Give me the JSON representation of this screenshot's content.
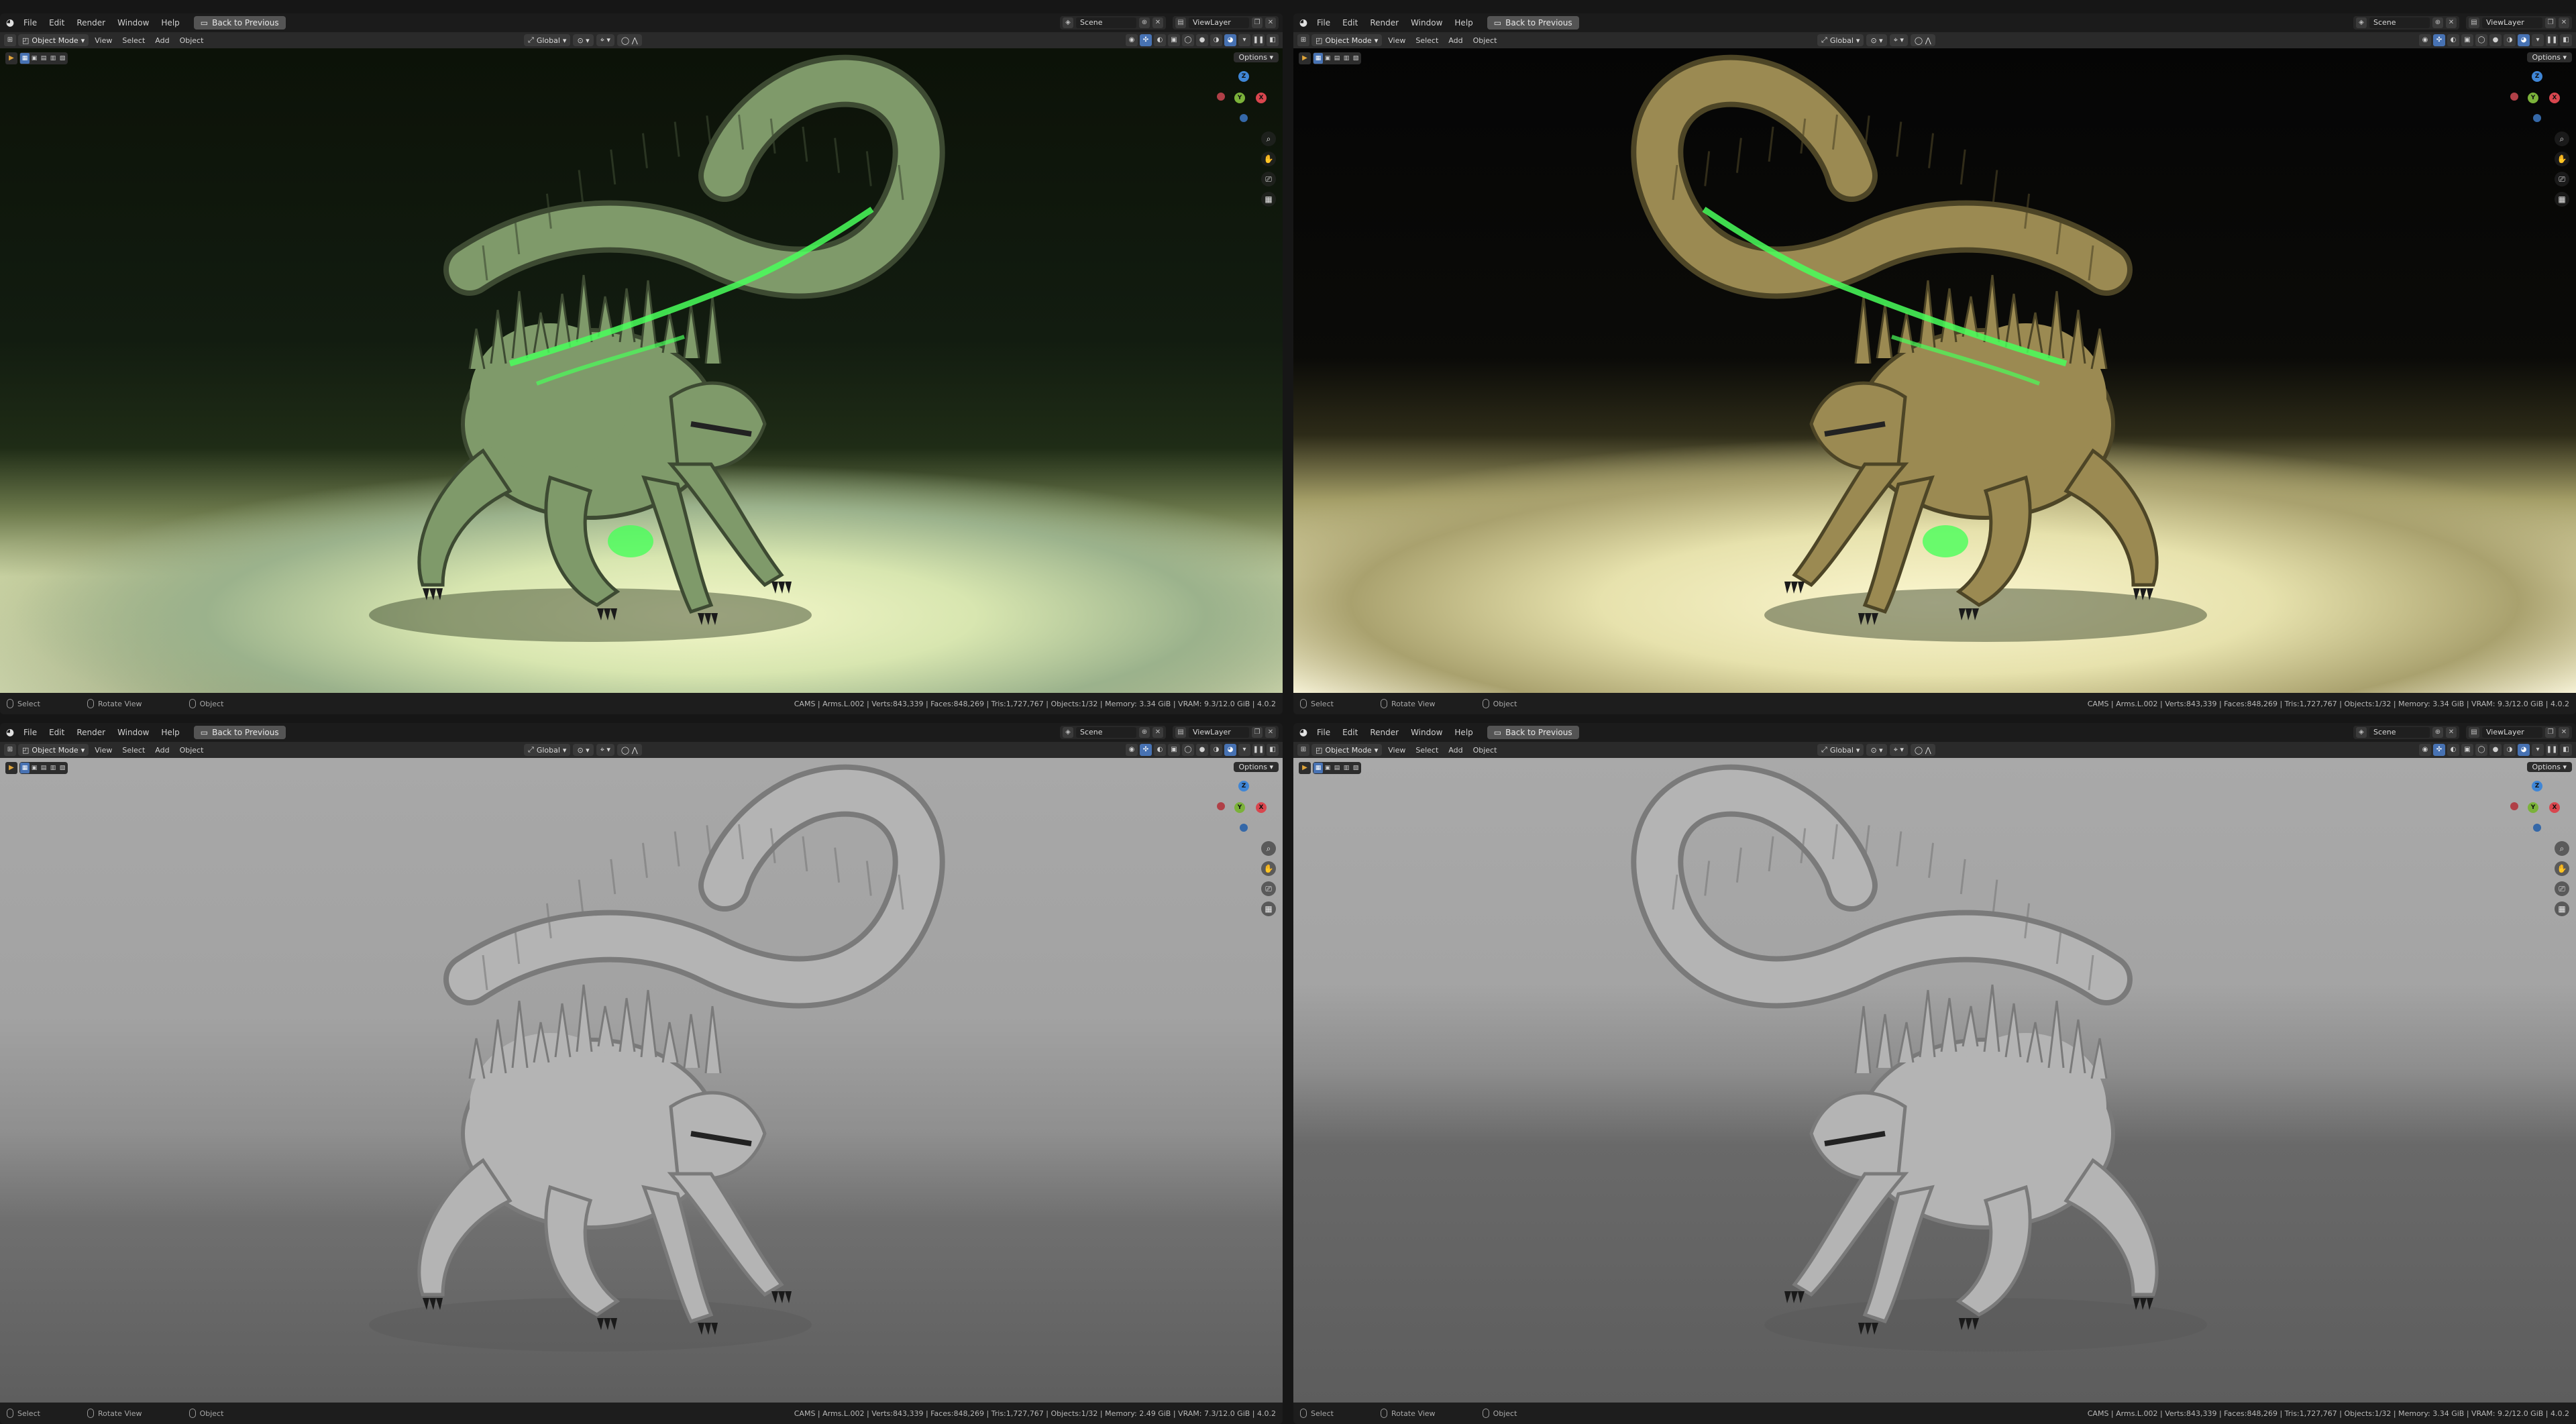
{
  "app": {
    "menus": [
      "File",
      "Edit",
      "Render",
      "Window",
      "Help"
    ],
    "back_button": "Back to Previous",
    "scene": "Scene",
    "view_layer": "ViewLayer"
  },
  "header": {
    "mode": "Object Mode",
    "menus": [
      "View",
      "Select",
      "Add",
      "Object"
    ],
    "transform_orientation": "Global",
    "options": "Options"
  },
  "gizmo": {
    "z": "Z",
    "y": "Y",
    "x": "X"
  },
  "windows": [
    {
      "shading": "rendered",
      "status": {
        "select": "Select",
        "rotate": "Rotate View",
        "object": "Object",
        "stats": "CAMS | Arms.L.002 | Verts:843,339 | Faces:848,269 | Tris:1,727,767 | Objects:1/32 | Memory: 3.34 GiB | VRAM: 9.3/12.0 GiB | 4.0.2"
      }
    },
    {
      "shading": "rendered",
      "status": {
        "select": "Select",
        "rotate": "Rotate View",
        "object": "Object",
        "stats": "CAMS | Arms.L.002 | Verts:843,339 | Faces:848,269 | Tris:1,727,767 | Objects:1/32 | Memory: 3.34 GiB | VRAM: 9.3/12.0 GiB | 4.0.2"
      }
    },
    {
      "shading": "solid",
      "status": {
        "select": "Select",
        "rotate": "Rotate View",
        "object": "Object",
        "stats": "CAMS | Arms.L.002 | Verts:843,339 | Faces:848,269 | Tris:1,727,767 | Objects:1/32 | Memory: 2.49 GiB | VRAM: 7.3/12.0 GiB | 4.0.2"
      }
    },
    {
      "shading": "solid",
      "status": {
        "select": "Select",
        "rotate": "Rotate View",
        "object": "Object",
        "stats": "CAMS | Arms.L.002 | Verts:843,339 | Faces:848,269 | Tris:1,727,767 | Objects:1/32 | Memory: 3.34 GiB | VRAM: 9.2/12.0 GiB | 4.0.2"
      }
    }
  ],
  "colors": {
    "accent": "#4772b3",
    "axis_x": "#d9464e",
    "axis_y": "#7bb23a",
    "axis_z": "#3f86d6",
    "creature_green": "#7f9a6a",
    "glow": "#49ff5a",
    "creature_gold": "#9b8a52",
    "clay": "#b4b4b4"
  }
}
